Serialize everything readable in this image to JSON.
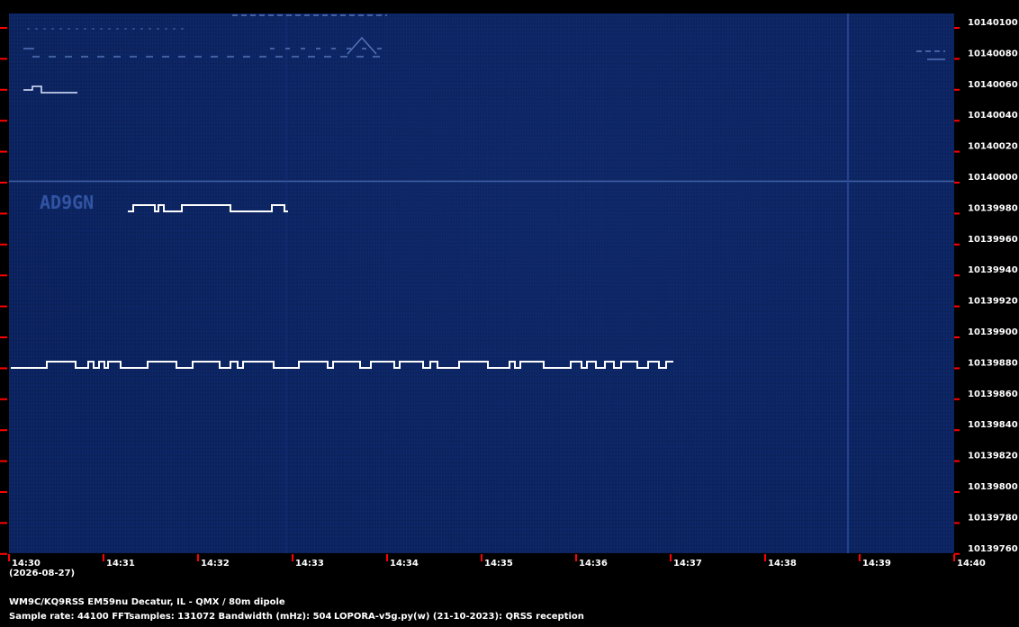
{
  "freq_labels": [
    "10140100",
    "10140080",
    "10140060",
    "10140040",
    "10140020",
    "10140000",
    "10139980",
    "10139960",
    "10139940",
    "10139920",
    "10139900",
    "10139880",
    "10139860",
    "10139840",
    "10139820",
    "10139800",
    "10139780",
    "10139760"
  ],
  "time_labels": [
    "14:30",
    "14:31",
    "14:32",
    "14:33",
    "14:34",
    "14:35",
    "14:36",
    "14:37",
    "14:38",
    "14:39",
    "14:40"
  ],
  "date_label": "(2026-08-27)",
  "station_line": "WM9C/KQ9RSS EM59nu Decatur, IL - QMX / 80m dipole",
  "params_line": "Sample rate: 44100    FFTsamples: 131072    Bandwidth (mHz): 504",
  "software_line": "LOPORA-v5g.py(w) (21-10-2023): QRSS reception",
  "colors": {
    "background": "#0a2260",
    "tick": "#ff0000",
    "signal": "#ffffff"
  },
  "faint_callsign_text": "AD9GN"
}
